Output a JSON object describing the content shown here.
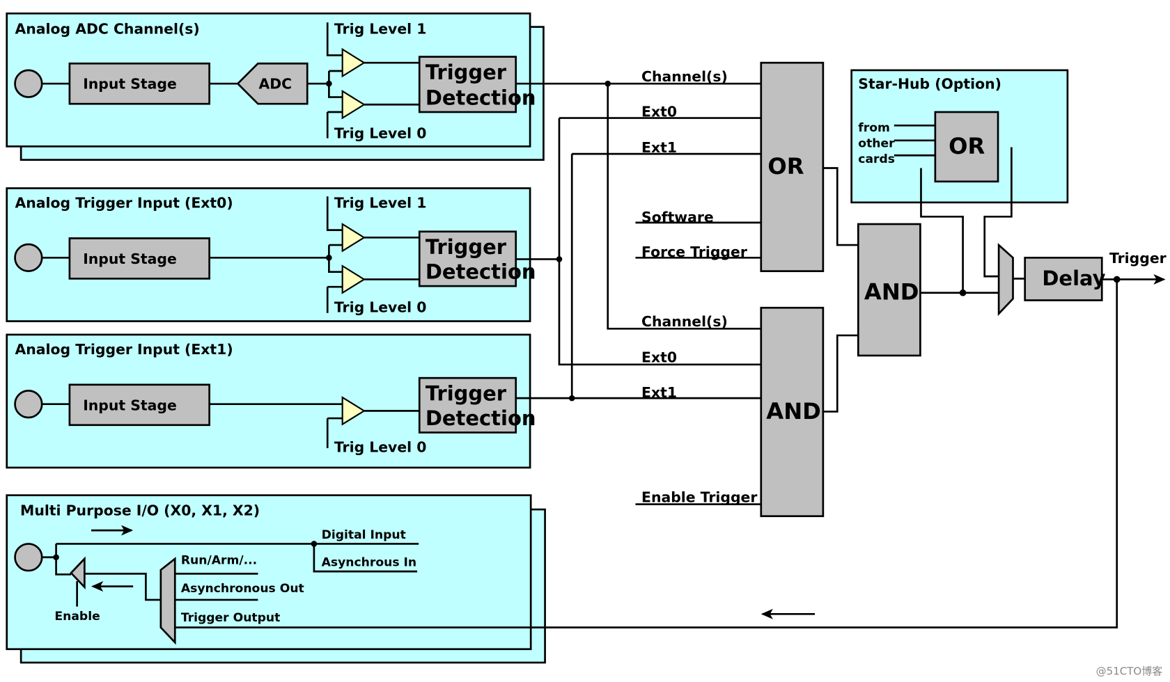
{
  "colors": {
    "panel": "#c0ffff",
    "block": "#c0c0c0",
    "comparator": "#ffffc0",
    "wire": "#000000"
  },
  "adc_channel": {
    "title": "Analog ADC Channel(s)",
    "input_stage": "Input Stage",
    "adc": "ADC",
    "trig_level_1": "Trig Level 1",
    "trig_level_0": "Trig Level 0",
    "trigger": "Trigger",
    "detection": "Detection"
  },
  "ext0": {
    "title": "Analog Trigger Input (Ext0)",
    "input_stage": "Input Stage",
    "trig_level_1": "Trig Level 1",
    "trig_level_0": "Trig Level 0",
    "trigger": "Trigger",
    "detection": "Detection"
  },
  "ext1": {
    "title": "Analog Trigger Input (Ext1)",
    "input_stage": "Input Stage",
    "trig_level_0": "Trig Level 0",
    "trigger": "Trigger",
    "detection": "Detection"
  },
  "or_inputs": [
    "Channel(s)",
    "Ext0",
    "Ext1",
    "Software",
    "Force Trigger"
  ],
  "and_inputs": [
    "Channel(s)",
    "Ext0",
    "Ext1",
    "Enable Trigger"
  ],
  "gates": {
    "or": "OR",
    "and_lower": "AND",
    "and_main": "AND",
    "delay": "Delay"
  },
  "star_hub": {
    "title": "Star-Hub (Option)",
    "from": "from",
    "other": "other",
    "cards": "cards",
    "or": "OR"
  },
  "output_label": "Trigger",
  "mpio": {
    "title": "Multi Purpose I/O (X0, X1, X2)",
    "digital_input": "Digital Input",
    "async_in": "Asynchrous In",
    "run_arm": "Run/Arm/...",
    "async_out": "Asynchronous Out",
    "trigger_output": "Trigger Output",
    "enable": "Enable"
  },
  "watermark": "@51CTO博客"
}
